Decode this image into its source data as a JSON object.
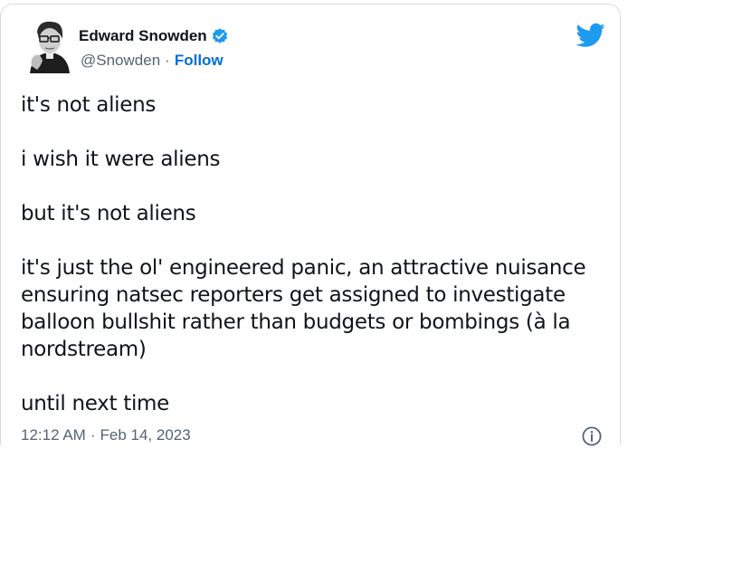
{
  "author": {
    "display_name": "Edward Snowden",
    "handle": "@Snowden",
    "separator": "·",
    "follow_label": "Follow",
    "verified": true
  },
  "tweet": {
    "paragraphs": [
      [
        "it's not aliens"
      ],
      [
        "i wish it were aliens"
      ],
      [
        "but it's not aliens"
      ],
      [
        "it's just the ol' engineered panic, an attractive nuisance",
        "ensuring natsec reporters get assigned to investigate",
        "balloon bullshit rather than budgets or bombings (à la",
        "nordstream)"
      ],
      [
        "until next time"
      ]
    ]
  },
  "meta": {
    "time": "12:12 AM",
    "separator": "·",
    "date": "Feb 14, 2023"
  },
  "icons": {
    "logo": "twitter-bird-icon",
    "verified": "verified-badge-icon",
    "info": "info-icon"
  },
  "colors": {
    "brand_blue": "#1d9bf0",
    "text": "#0f1419",
    "secondary": "#536471",
    "follow": "#006fd6"
  }
}
